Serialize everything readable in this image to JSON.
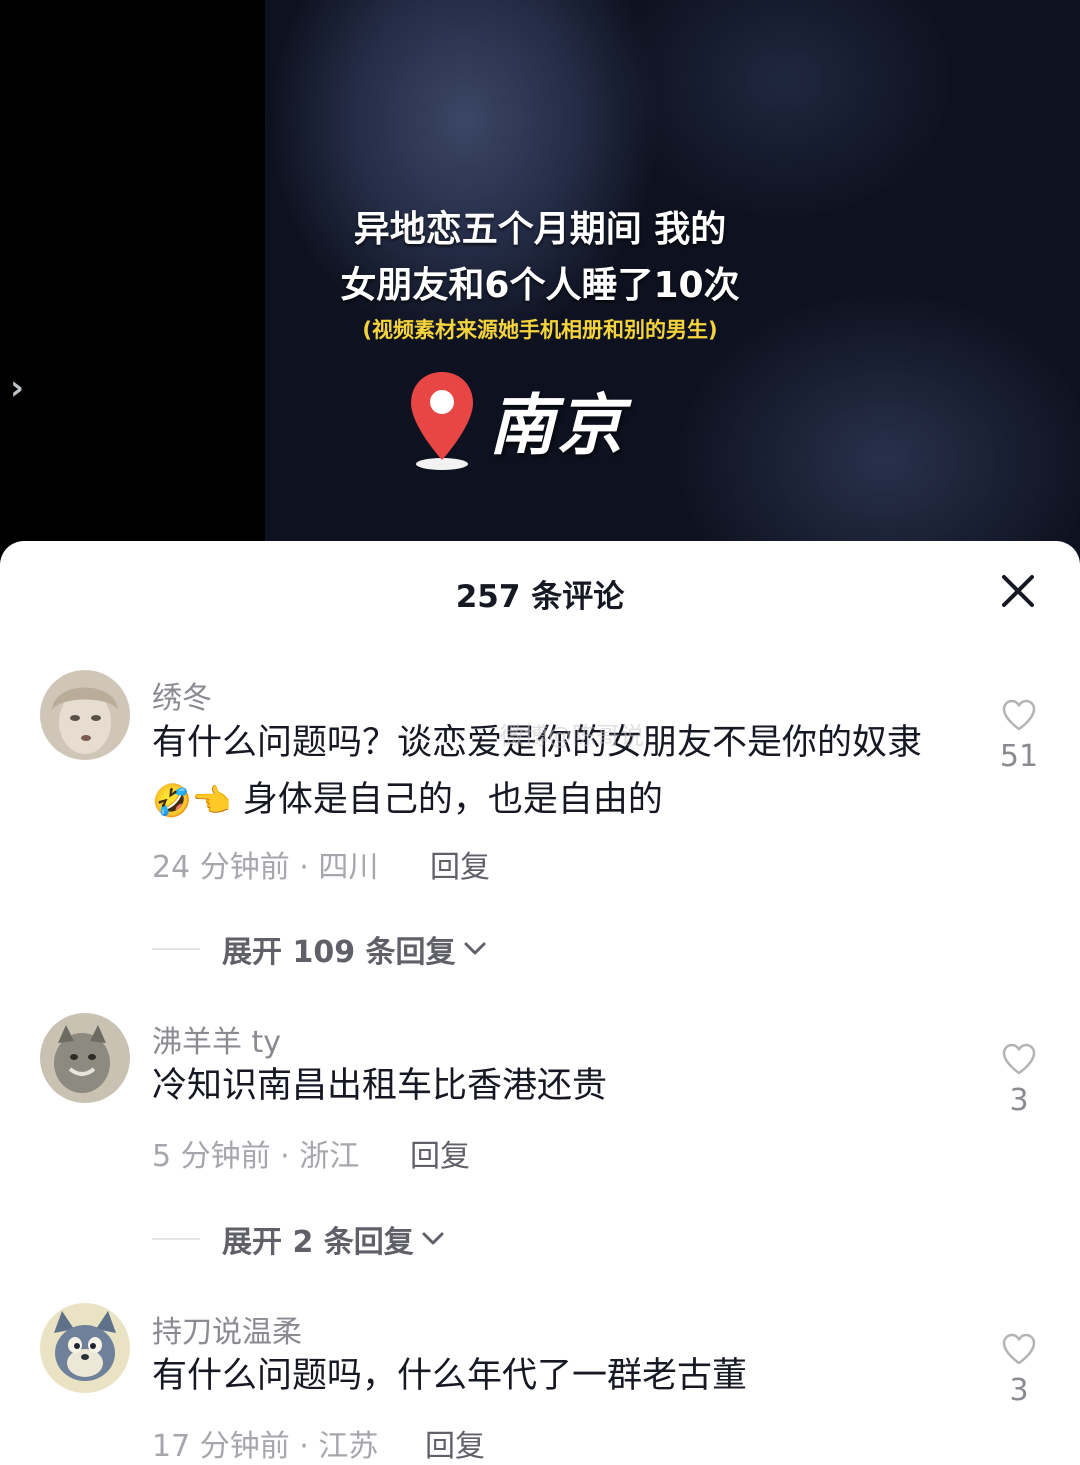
{
  "video": {
    "overlay_line1": "异地恋五个月期间 我的",
    "overlay_line2": "女朋友和6个人睡了10次",
    "overlay_sub": "(视频素材来源她手机相册和别的男生)",
    "location": "南京",
    "location_pin_color": "#e84545",
    "side_arrow": "›"
  },
  "sheet": {
    "title": "257 条评论",
    "close_icon": "close-icon"
  },
  "comments": [
    {
      "username": "绣冬",
      "text_part1": "有什么问题吗？谈恋爱是你的女朋友不是你的奴隶",
      "emoji1": "🤣",
      "emoji2": "👈",
      "text_part2": " 身体是自己的，也是自由的",
      "meta": "24 分钟前 · 四川",
      "reply_label": "回复",
      "likes": "51",
      "expand_label": "展开 109 条回复"
    },
    {
      "username": "沸羊羊 ty",
      "text": "冷知识南昌出租车比香港还贵",
      "meta": "5 分钟前 · 浙江",
      "reply_label": "回复",
      "likes": "3",
      "expand_label": "展开 2 条回复"
    },
    {
      "username": "持刀说温柔",
      "text": "有什么问题吗，什么年代了一群老古董",
      "meta": "17 分钟前 · 江苏",
      "reply_label": "回复",
      "likes": "3"
    }
  ],
  "watermark": "微博@陈哥说"
}
